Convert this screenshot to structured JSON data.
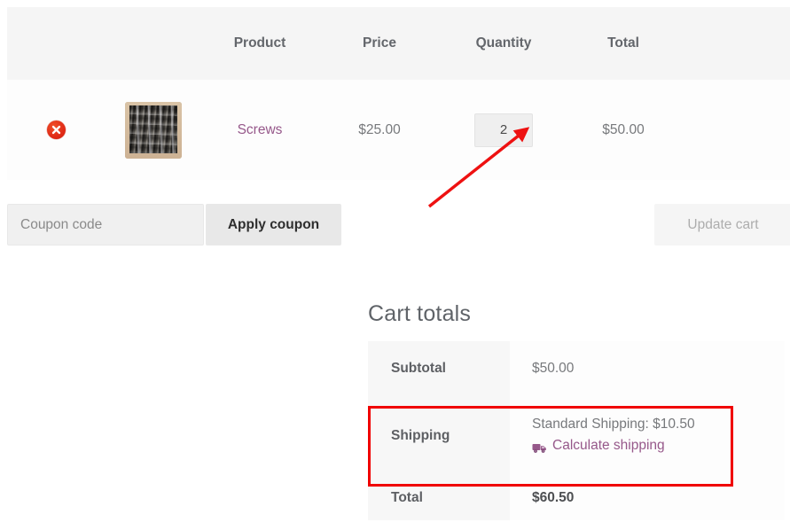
{
  "cart_table": {
    "headers": [
      "",
      "",
      "Product",
      "Price",
      "Quantity",
      "Total",
      ""
    ],
    "rows": [
      {
        "remove_label": "×",
        "remove_title": "Remove this item",
        "thumb_alt": "Screws",
        "product": "Screws",
        "price": "$25.00",
        "quantity": "2",
        "total": "$50.00"
      }
    ]
  },
  "actions": {
    "coupon_placeholder": "Coupon code",
    "coupon_value": "",
    "apply_coupon_label": "Apply coupon",
    "update_cart_label": "Update cart"
  },
  "cart_totals": {
    "heading": "Cart totals",
    "rows": [
      {
        "label": "Subtotal",
        "value": "$50.00"
      },
      {
        "label": "Shipping",
        "value": "Standard Shipping: $10.50",
        "link": "Calculate shipping",
        "link_icon": "delivery-truck-icon"
      },
      {
        "label": "Total",
        "value": "$60.50"
      }
    ]
  },
  "annotations": {
    "highlight_color": "#f00000",
    "arrow_color": "#ee1111",
    "arrow_target": "quantity-input",
    "highlight_target": "shipping-row"
  },
  "colors": {
    "link": "#96588a",
    "header_bg": "#f5f5f5",
    "row_bg": "#fdfdfd",
    "text": "#77797c",
    "remove_badge": "#e02a16"
  }
}
